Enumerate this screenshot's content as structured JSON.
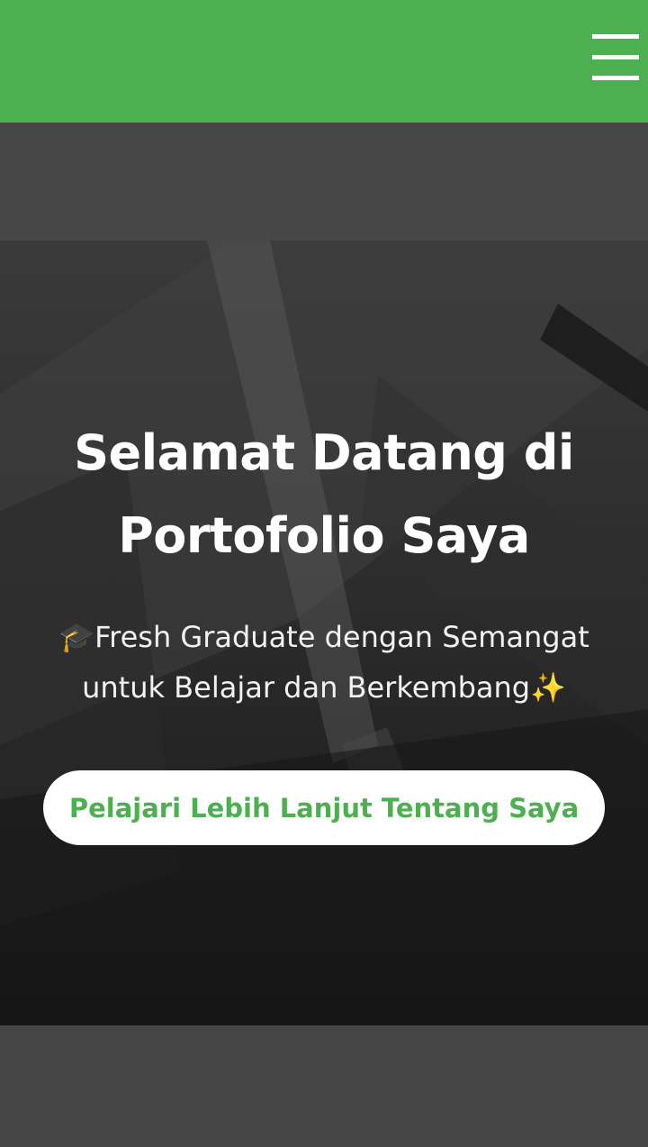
{
  "header": {
    "menu_icon": "hamburger-menu-icon",
    "brand_color": "#4caf50"
  },
  "hero": {
    "title": "Selamat Datang di Portofolio Saya",
    "subtitle": "🎓Fresh Graduate dengan Semangat untuk Belajar dan Berkembang✨",
    "cta_label": "Pelajari Lebih Lanjut Tentang Saya",
    "cta_text_color": "#4caf50",
    "background_image": "desk-notebook-pen-photo"
  }
}
